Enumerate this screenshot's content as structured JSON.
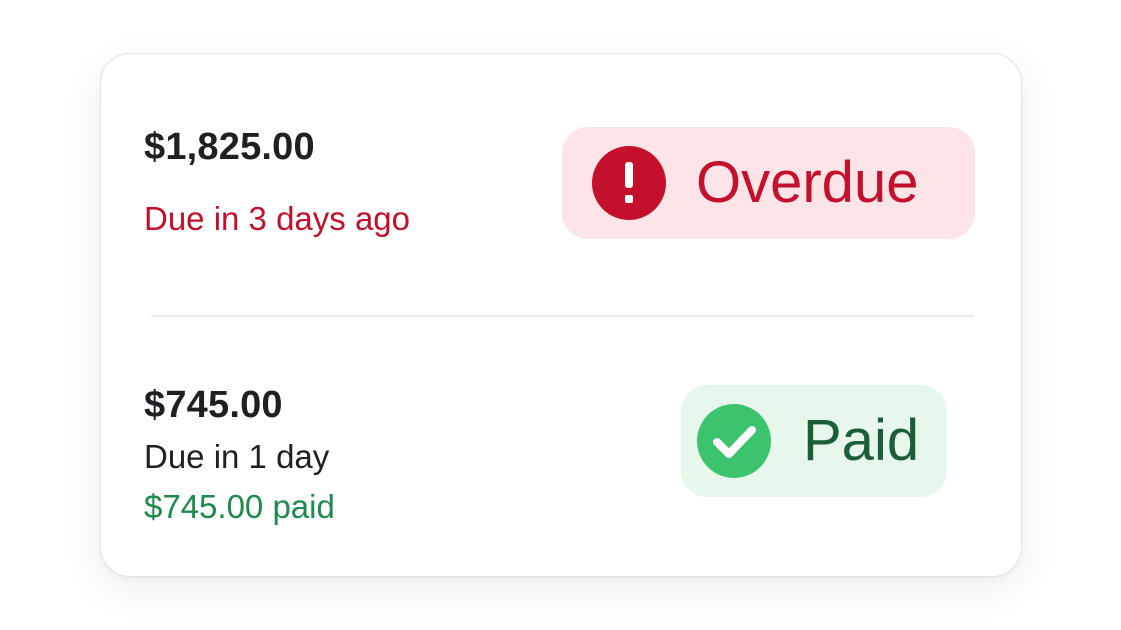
{
  "invoices": [
    {
      "amount": "$1,825.00",
      "due_text": "Due in 3 days ago",
      "status": {
        "label": "Overdue",
        "icon": "alert-circle-icon",
        "color": "#c4102c",
        "background": "#fde4e6"
      }
    },
    {
      "amount": "$745.00",
      "due_text": "Due in 1 day",
      "paid_text": "$745.00 paid",
      "status": {
        "label": "Paid",
        "icon": "check-circle-icon",
        "color": "#1b5e37",
        "background": "#e8f7ec",
        "icon_color": "#3cc36d"
      }
    }
  ]
}
